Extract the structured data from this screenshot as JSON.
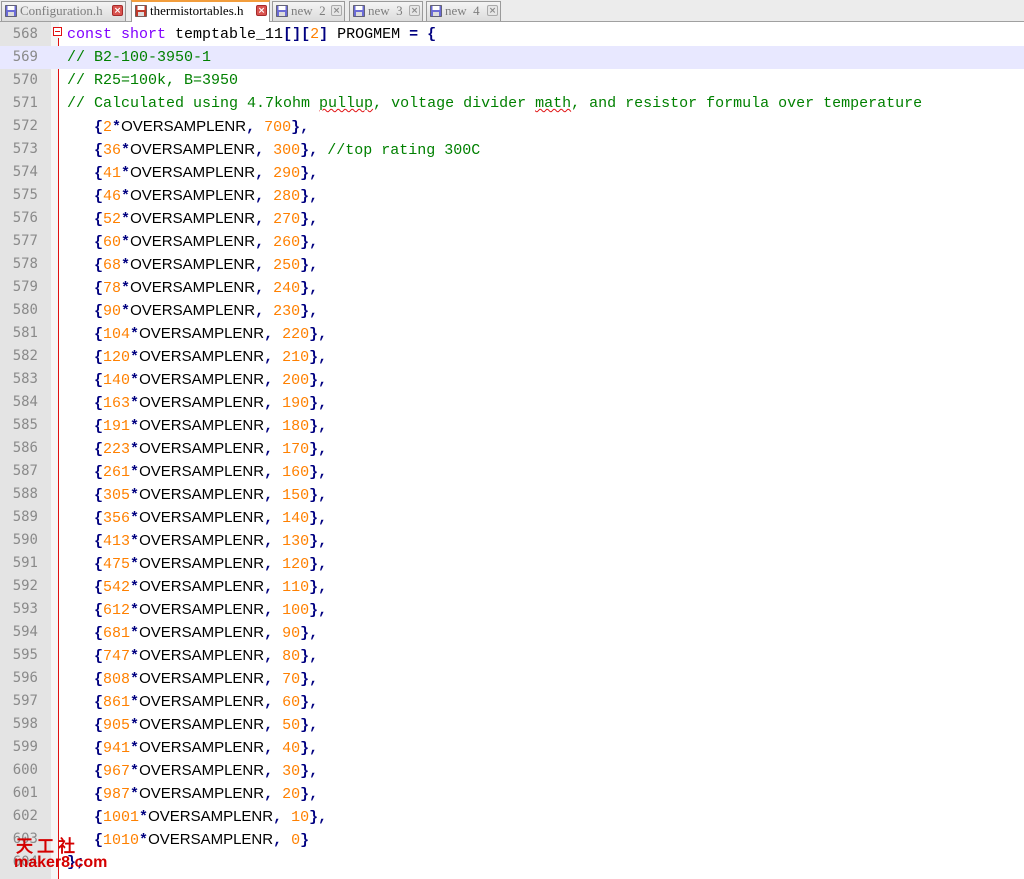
{
  "tabs": [
    {
      "label": "Configuration.h",
      "active": false,
      "close": "red"
    },
    {
      "label": "thermistortables.h",
      "active": true,
      "close": "red"
    },
    {
      "label": "new  2",
      "active": false,
      "close": "grey"
    },
    {
      "label": "new  3",
      "active": false,
      "close": "grey"
    },
    {
      "label": "new  4",
      "active": false,
      "close": "grey"
    }
  ],
  "editor": {
    "current_line": 569,
    "lines": [
      {
        "n": "568",
        "tokens": [
          {
            "t": "const short",
            "c": "kw"
          },
          {
            "t": " temptable_11",
            "c": "plain"
          },
          {
            "t": "[][",
            "c": "op"
          },
          {
            "t": "2",
            "c": "num"
          },
          {
            "t": "]",
            "c": "op"
          },
          {
            "t": " PROGMEM ",
            "c": "plain"
          },
          {
            "t": "= {",
            "c": "op"
          }
        ]
      },
      {
        "n": "569",
        "tokens": [
          {
            "t": "// B2-100-3950-1",
            "c": "comment"
          }
        ]
      },
      {
        "n": "570",
        "tokens": [
          {
            "t": "// R25=100k, B=3950",
            "c": "comment"
          }
        ]
      },
      {
        "n": "571",
        "tokens": [
          {
            "t": "// Calculated using 4.7kohm ",
            "c": "comment"
          },
          {
            "t": "pullup",
            "c": "comment",
            "sq": true
          },
          {
            "t": ", voltage divider ",
            "c": "comment"
          },
          {
            "t": "math",
            "c": "comment",
            "sq": true
          },
          {
            "t": ", and resistor formula over temperature",
            "c": "comment"
          }
        ]
      },
      {
        "n": "572",
        "row": [
          "2",
          "700"
        ]
      },
      {
        "n": "573",
        "row": [
          "36",
          "300"
        ],
        "comment": "//top rating 300C"
      },
      {
        "n": "574",
        "row": [
          "41",
          "290"
        ]
      },
      {
        "n": "575",
        "row": [
          "46",
          "280"
        ]
      },
      {
        "n": "576",
        "row": [
          "52",
          "270"
        ]
      },
      {
        "n": "577",
        "row": [
          "60",
          "260"
        ]
      },
      {
        "n": "578",
        "row": [
          "68",
          "250"
        ]
      },
      {
        "n": "579",
        "row": [
          "78",
          "240"
        ]
      },
      {
        "n": "580",
        "row": [
          "90",
          "230"
        ]
      },
      {
        "n": "581",
        "row": [
          "104",
          "220"
        ]
      },
      {
        "n": "582",
        "row": [
          "120",
          "210"
        ]
      },
      {
        "n": "583",
        "row": [
          "140",
          "200"
        ]
      },
      {
        "n": "584",
        "row": [
          "163",
          "190"
        ]
      },
      {
        "n": "585",
        "row": [
          "191",
          "180"
        ]
      },
      {
        "n": "586",
        "row": [
          "223",
          "170"
        ]
      },
      {
        "n": "587",
        "row": [
          "261",
          "160"
        ]
      },
      {
        "n": "588",
        "row": [
          "305",
          "150"
        ]
      },
      {
        "n": "589",
        "row": [
          "356",
          "140"
        ]
      },
      {
        "n": "590",
        "row": [
          "413",
          "130"
        ]
      },
      {
        "n": "591",
        "row": [
          "475",
          "120"
        ]
      },
      {
        "n": "592",
        "row": [
          "542",
          "110"
        ]
      },
      {
        "n": "593",
        "row": [
          "612",
          "100"
        ]
      },
      {
        "n": "594",
        "row": [
          "681",
          "90"
        ]
      },
      {
        "n": "595",
        "row": [
          "747",
          "80"
        ]
      },
      {
        "n": "596",
        "row": [
          "808",
          "70"
        ]
      },
      {
        "n": "597",
        "row": [
          "861",
          "60"
        ]
      },
      {
        "n": "598",
        "row": [
          "905",
          "50"
        ]
      },
      {
        "n": "599",
        "row": [
          "941",
          "40"
        ]
      },
      {
        "n": "600",
        "row": [
          "967",
          "30"
        ]
      },
      {
        "n": "601",
        "row": [
          "987",
          "20"
        ]
      },
      {
        "n": "602",
        "row": [
          "1001",
          "10"
        ]
      },
      {
        "n": "603",
        "row": [
          "1010",
          "0"
        ],
        "last": true
      },
      {
        "n": "604",
        "tokens": [
          {
            "t": "};",
            "c": "op"
          }
        ]
      }
    ]
  },
  "watermark": {
    "cn": "天工社",
    "url": "maker8.com"
  },
  "colors": {
    "keyword": "#8000ff",
    "number": "#ff8000",
    "operator": "#000080",
    "comment": "#008000",
    "fold": "#e01010",
    "active_tab_accent": "#f29d3c",
    "current_line_bg": "#e8e8ff",
    "watermark": "#d40000"
  },
  "icons": {
    "tab_file": "floppy-save-icon",
    "tab_close": "close-x-icon",
    "fold": "fold-minus-icon"
  },
  "macro": "OVERSAMPLENR"
}
